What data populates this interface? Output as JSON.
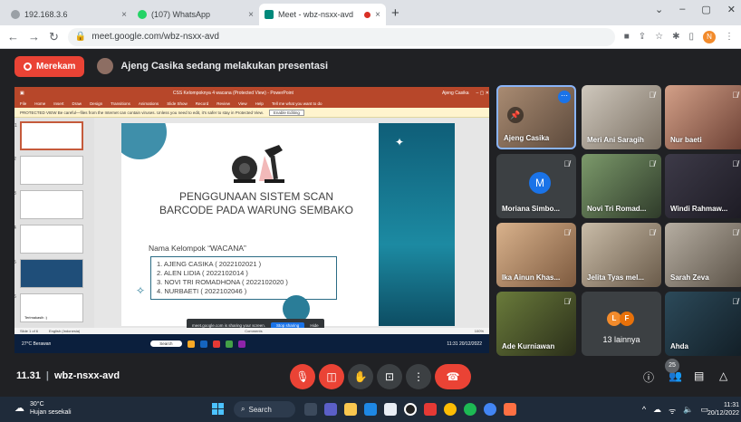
{
  "browser": {
    "tabs": [
      {
        "title": "192.168.3.6",
        "close": "×",
        "active": false
      },
      {
        "title": "(107) WhatsApp",
        "close": "×",
        "active": false
      },
      {
        "title": "Meet - wbz-nsxx-avd",
        "close": "×",
        "active": true
      }
    ],
    "new_tab": "+",
    "window_controls": [
      "⌄",
      "–",
      "▢",
      "✕"
    ],
    "url": "meet.google.com/wbz-nsxx-avd",
    "profile_initial": "N"
  },
  "meet": {
    "record_label": "Merekam",
    "presenting_message": "Ajeng Casika sedang melakukan presentasi"
  },
  "presentation": {
    "ppt_title": "CSS Kelompoknya 4 wacana (Protected View) - PowerPoint",
    "ppt_user": "Ajeng Casika",
    "ribbon": [
      "File",
      "Home",
      "Insert",
      "Draw",
      "Design",
      "Transitions",
      "Animations",
      "Slide Show",
      "Record",
      "Review",
      "View",
      "Help",
      "Tell me what you want to do"
    ],
    "warning": "PROTECTED VIEW  Be careful—files from the Internet can contain viruses. Unless you need to edit, it's safer to stay in Protected View.",
    "enable_editing": "Enable Editing",
    "thumb_numbers": [
      "1",
      "2",
      "3",
      "4",
      "5",
      "6"
    ],
    "thumb_label": "Terimakasih :)",
    "slide_title": "PENGGUNAAN SISTEM SCAN BARCODE PADA WARUNG SEMBAKO",
    "group_name": "Nama Kelompok “WACANA”",
    "members": [
      "1.  AJENG CASIKA ( 2022102021 )",
      "2.  ALEN LIDIA  ( 2022102014 )",
      "3.  NOVI TRI ROMADHONA ( 2022102020 )",
      "4.  NURBAETI ( 2022102046 )"
    ],
    "share_notice": "meet.google.com is sharing your screen.",
    "stop_sharing": "Stop sharing",
    "hide": "Hide",
    "status_left": "Slide 1 of 6",
    "status_lang": "English (Indonesia)",
    "status_comments": "Comments",
    "zoom": "100%",
    "inner_weather": "27°C Berawan",
    "inner_search": "Search",
    "inner_time": "11:31",
    "inner_date": "20/12/2022"
  },
  "participants": [
    {
      "name": "Ajeng Casika",
      "muted": false
    },
    {
      "name": "Meri Ani Saragih",
      "muted": true
    },
    {
      "name": "Nur baeti",
      "muted": true
    },
    {
      "name": "Moriana Simbo...",
      "muted": true,
      "initial": "M"
    },
    {
      "name": "Novi Tri Romad...",
      "muted": true
    },
    {
      "name": "Windi Rahmaw...",
      "muted": true
    },
    {
      "name": "Ika Ainun Khas...",
      "muted": true
    },
    {
      "name": "Jelita Tyas mel...",
      "muted": true
    },
    {
      "name": "Sarah Zeva",
      "muted": true
    },
    {
      "name": "Ade Kurniawan",
      "muted": true
    },
    {
      "name": "13 lainnya",
      "initials": [
        "L",
        "F"
      ]
    },
    {
      "name": "Ahda",
      "muted": true
    }
  ],
  "participant_count": "25",
  "controls": {
    "time": "11.31",
    "meeting_code": "wbz-nsxx-avd"
  },
  "taskbar": {
    "temperature": "30°C",
    "weather": "Hujan sesekali",
    "search": "Search",
    "time": "11:31",
    "date": "20/12/2022"
  }
}
